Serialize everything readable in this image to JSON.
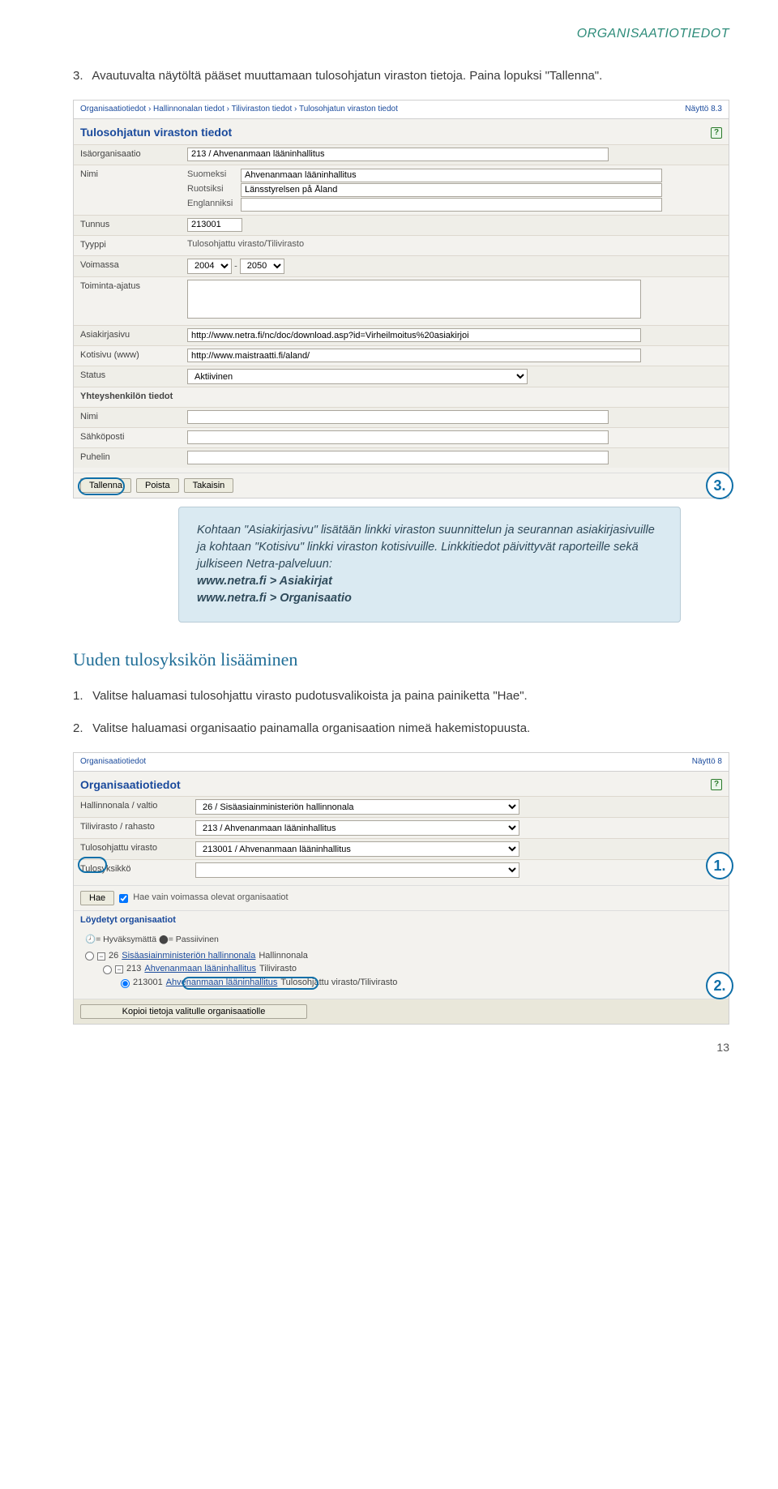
{
  "header": {
    "section": "ORGANISAATIOTIEDOT"
  },
  "intro": {
    "num": "3.",
    "text": "Avautuvalta näytöltä pääset muuttamaan tulosohjatun viraston tietoja. Paina lopuksi \"Tallenna\"."
  },
  "ss1": {
    "breadcrumb": "Organisaatiotiedot › Hallinnonalan tiedot › Tiliviraston tiedot › Tulosohjatun viraston tiedot",
    "screen_id": "Näyttö 8.3",
    "title": "Tulosohjatun viraston tiedot",
    "labels": {
      "isaorganisaatio": "Isäorganisaatio",
      "nimi": "Nimi",
      "suomeksi": "Suomeksi",
      "ruotsiksi": "Ruotsiksi",
      "englanniksi": "Englanniksi",
      "tunnus": "Tunnus",
      "tyyppi": "Tyyppi",
      "voimassa": "Voimassa",
      "toiminta": "Toiminta-ajatus",
      "asiakirjasivu": "Asiakirjasivu",
      "kotisivu": "Kotisivu (www)",
      "status": "Status",
      "yhteys": "Yhteyshenkilön tiedot",
      "yhteys_nimi": "Nimi",
      "sahkoposti": "Sähköposti",
      "puhelin": "Puhelin"
    },
    "values": {
      "isaorganisaatio": "213 / Ahvenanmaan lääninhallitus",
      "nimi_fi": "Ahvenanmaan lääninhallitus",
      "nimi_sv": "Länsstyrelsen på Åland",
      "nimi_en": "",
      "tunnus": "213001",
      "tyyppi": "Tulosohjattu virasto/Tilivirasto",
      "voimassa_from": "2004",
      "voimassa_to": "2050",
      "asiakirjasivu": "http://www.netra.fi/nc/doc/download.asp?id=Virheilmoitus%20asiakirjoi",
      "kotisivu": "http://www.maistraatti.fi/aland/",
      "status": "Aktiivinen"
    },
    "buttons": {
      "tallenna": "Tallenna",
      "poista": "Poista",
      "takaisin": "Takaisin"
    },
    "callout": "3."
  },
  "info": {
    "p1a": "Kohtaan \"Asiakirjasivu\" lisätään linkki viraston suunnittelun ja seurannan asiakirjasivuille ja kohtaan \"Kotisivu\" linkki viraston kotisivuille. Linkkitiedot päivittyvät raporteille sekä julkiseen Netra-palveluun:",
    "l1": "www.netra.fi > Asiakirjat",
    "l2": "www.netra.fi > Organisaatio"
  },
  "section2": {
    "heading": "Uuden tulosyksikön lisääminen"
  },
  "steps2": {
    "s1_num": "1.",
    "s1": "Valitse haluamasi tulosohjattu virasto pudotusvalikoista ja paina painiketta \"Hae\".",
    "s2_num": "2.",
    "s2": "Valitse haluamasi organisaatio painamalla organisaation nimeä hakemistopuusta."
  },
  "ss2": {
    "breadcrumb": "Organisaatiotiedot",
    "screen_id": "Näyttö 8",
    "title": "Organisaatiotiedot",
    "labels": {
      "hallinnonala": "Hallinnonala / valtio",
      "tilivirasto": "Tilivirasto / rahasto",
      "tulosohjattu": "Tulosohjattu virasto",
      "tulosyksikko": "Tulosyksikkö"
    },
    "values": {
      "hallinnonala": "26 / Sisäasiainministeriön hallinnonala",
      "tilivirasto": "213 / Ahvenanmaan lääninhallitus",
      "tulosohjattu": "213001 / Ahvenanmaan lääninhallitus",
      "tulosyksikko": ""
    },
    "hae": "Hae",
    "hae_checkbox_label": "Hae vain voimassa olevat organisaatiot",
    "found_header": "Löydetyt organisaatiot",
    "legend": "🕗= Hyväksymättä  ⬤= Passiivinen",
    "tree": {
      "l1_code": "26",
      "l1_link": "Sisäasiainministeriön hallinnonala",
      "l1_suffix": "Hallinnonala",
      "l2_code": "213",
      "l2_link": "Ahvenanmaan lääninhallitus",
      "l2_suffix": "Tilivirasto",
      "l3_code": "213001",
      "l3_link": "Ahvenanmaan lääninhallitus",
      "l3_suffix": "Tulosohjattu virasto/Tilivirasto"
    },
    "kopioi": "Kopioi tietoja valitulle organisaatiolle",
    "callout1": "1.",
    "callout2": "2."
  },
  "page_number": "13"
}
